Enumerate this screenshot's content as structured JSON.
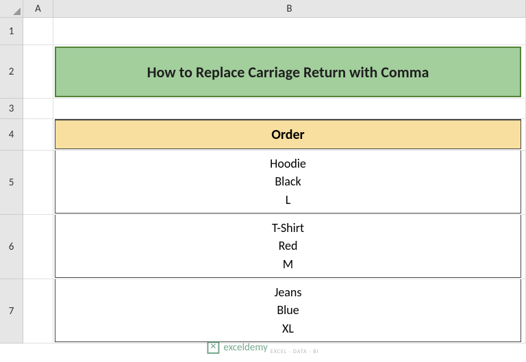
{
  "columns": [
    "A",
    "B"
  ],
  "rows": [
    "1",
    "2",
    "3",
    "4",
    "5",
    "6",
    "7"
  ],
  "title": "How to Replace Carriage Return with Comma",
  "table": {
    "header": "Order",
    "rows": [
      {
        "line1": "Hoodie",
        "line2": "Black",
        "line3": "L"
      },
      {
        "line1": "T-Shirt",
        "line2": "Red",
        "line3": "M"
      },
      {
        "line1": "Jeans",
        "line2": "Blue",
        "line3": "XL"
      }
    ]
  },
  "watermark": {
    "brand": "exceldemy",
    "tagline": "EXCEL · DATA · BI"
  }
}
